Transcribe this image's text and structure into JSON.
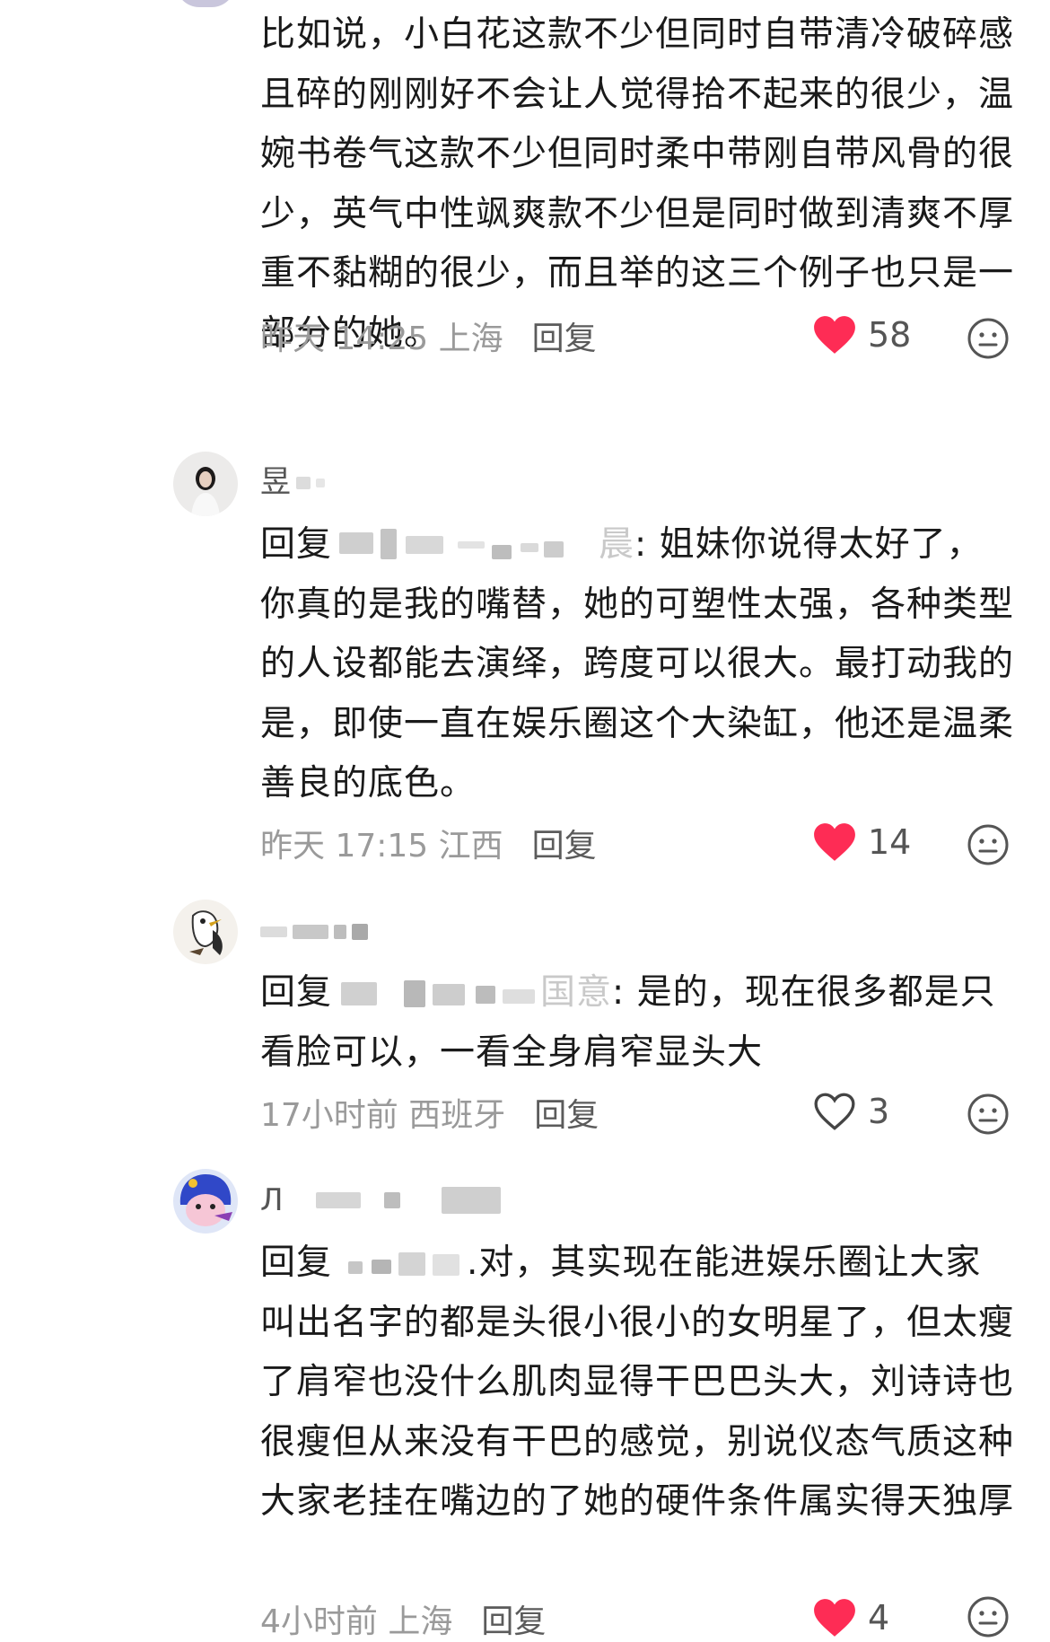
{
  "comments": [
    {
      "text": "比如说，小白花这款不少但同时自带清冷破碎感且碎的刚刚好不会让人觉得拾不起来的很少，温婉书卷气这款不少但同时柔中带刚自带风骨的很少，英气中性飒爽款不少但是同时做到清爽不厚重不黏糊的很少，而且举的这三个例子也只是一部分的她。",
      "time": "昨天 14:25 上海",
      "reply": "回复",
      "likes": "58",
      "liked": true
    },
    {
      "username_partial": "昱",
      "reply_prefix": "回复",
      "reply_target_tail": "晨",
      "text": ": 姐妹你说得太好了，你真的是我的嘴替，她的可塑性太强，各种类型的人设都能去演绎，跨度可以很大。最打动我的是，即使一直在娱乐圈这个大染缸，他还是温柔善良的底色。",
      "time": "昨天 17:15 江西",
      "reply": "回复",
      "likes": "14",
      "liked": true
    },
    {
      "reply_prefix": "回复",
      "reply_target_tail": "国意",
      "text": ": 是的，现在很多都是只看脸可以，一看全身肩窄显头大",
      "time": "17小时前 西班牙",
      "reply": "回复",
      "likes": "3",
      "liked": false
    },
    {
      "username_partial": "Л",
      "reply_prefix": "回复",
      "text": ".对，其实现在能进娱乐圈让大家叫出名字的都是头很小很小的女明星了，但太瘦了肩窄也没什么肌肉显得干巴巴头大，刘诗诗也很瘦但从来没有干巴的感觉，别说仪态气质这种大家老挂在嘴边的了她的硬件条件属实得天独厚",
      "time": "4小时前 上海",
      "reply": "回复",
      "likes": "4",
      "liked": true
    }
  ],
  "colors": {
    "heart": "#fe2c55",
    "meta": "#9a9a9a",
    "text": "#1a1a1a"
  },
  "icons": {
    "like": "heart-icon",
    "dislike": "neutral-face-icon"
  }
}
